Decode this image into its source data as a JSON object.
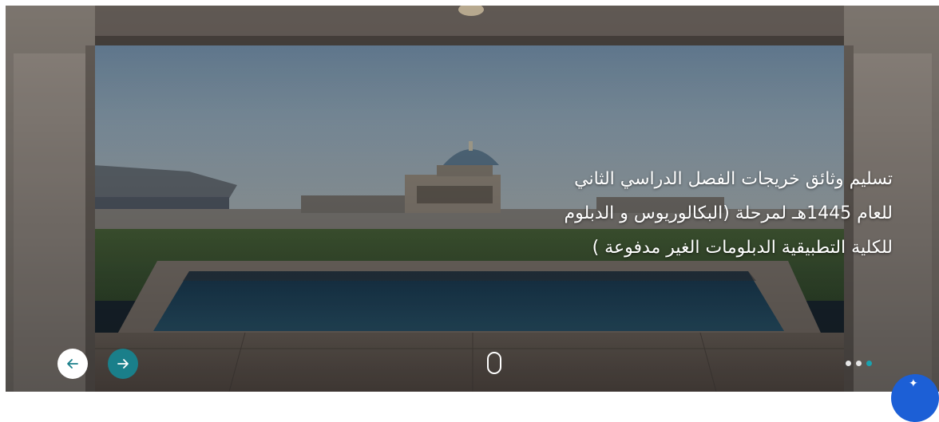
{
  "slide": {
    "caption_line1": "تسليم وثائق خريجات الفصل الدراسي الثاني",
    "caption_line2": "للعام 1445هـ لمرحلة (البكالوريوس و الدبلوم",
    "caption_line3": "للكلية التطبيقية الدبلومات الغير مدفوعة )"
  },
  "controls": {
    "prev_icon": "arrow-left-icon",
    "next_icon": "arrow-right-icon",
    "scroll_icon": "mouse-scroll-icon",
    "pagination_count": 3,
    "active_index": 2,
    "accent_color": "#1a7f8a",
    "fab_color": "#1c5fd6"
  }
}
